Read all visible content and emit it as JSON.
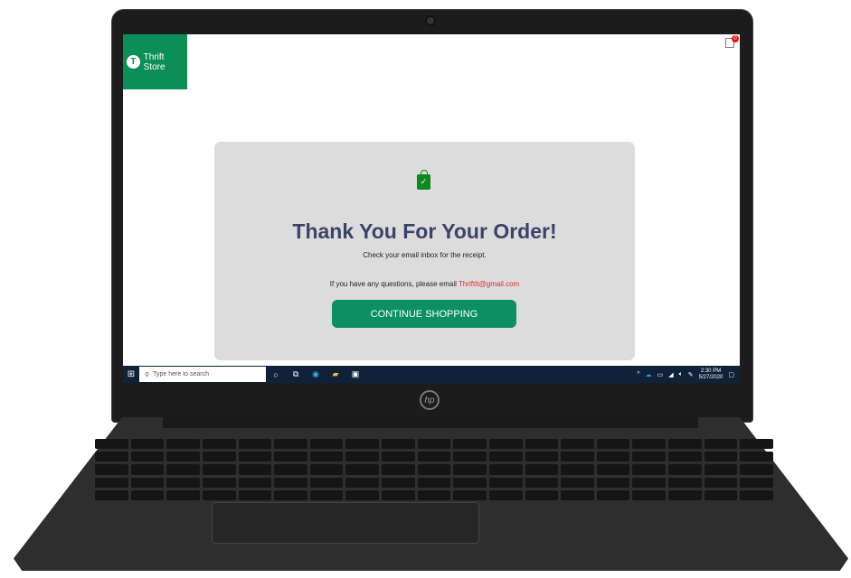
{
  "store": {
    "logo_letter": "T",
    "name": "Thrift Store",
    "cart_count": "0"
  },
  "order": {
    "title": "Thank You For Your Order!",
    "subtitle": "Check your email inbox for the receipt.",
    "question": "If you have any questions, please email",
    "email": "ThriftIt@gmail.com",
    "button": "CONTINUE SHOPPING",
    "check": "✓"
  },
  "taskbar": {
    "search_placeholder": "Type here to search",
    "time": "2:30 PM",
    "date": "5/27/2020"
  },
  "laptop": {
    "brand": "hp"
  }
}
